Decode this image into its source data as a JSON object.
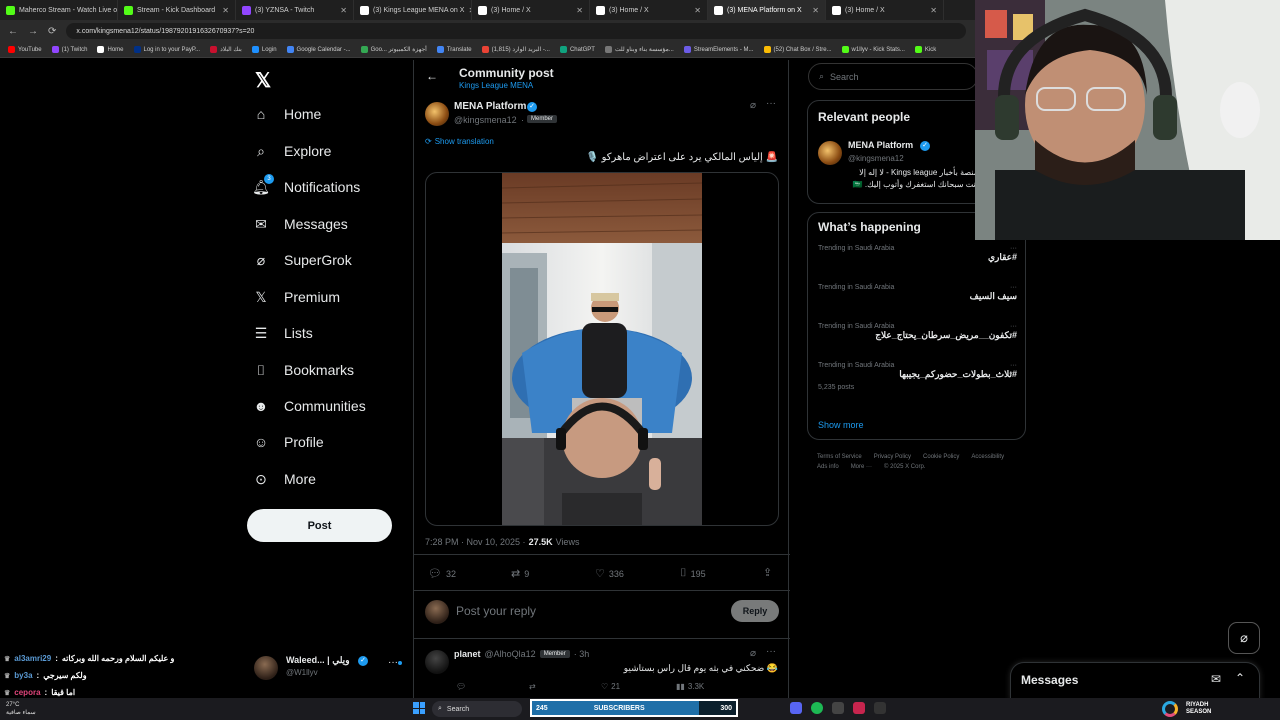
{
  "browser": {
    "tabs": [
      {
        "label": "Maherco Stream - Watch Live o",
        "color": "#53fc18"
      },
      {
        "label": "Stream - Kick Dashboard",
        "color": "#53fc18"
      },
      {
        "label": "(3) YZNSA - Twitch",
        "color": "#9146ff"
      },
      {
        "label": "(3) Kings League MENA on X",
        "color": "#ffffff"
      },
      {
        "label": "(3) Home / X",
        "color": "#ffffff"
      },
      {
        "label": "(3) Home / X",
        "color": "#ffffff"
      },
      {
        "label": "(3) MENA Platform on X",
        "color": "#ffffff"
      },
      {
        "label": "(3) Home / X",
        "color": "#ffffff"
      }
    ],
    "url": "x.com/kingsmena12/status/1987920191632670937?s=20",
    "bookmarks": [
      {
        "label": "YouTube",
        "color": "#ff0000"
      },
      {
        "label": "(1) Twitch",
        "color": "#9146ff"
      },
      {
        "label": "Home",
        "color": "#ffffff"
      },
      {
        "label": "Log in to your PayP...",
        "color": "#003087"
      },
      {
        "label": "بنك البلاد",
        "color": "#c8102e"
      },
      {
        "label": "Login",
        "color": "#1e90ff"
      },
      {
        "label": "Google Calendar -...",
        "color": "#4285f4"
      },
      {
        "label": "Goo... أجهزة الكمبيوتر",
        "color": "#34a853"
      },
      {
        "label": "Translate",
        "color": "#4285f4"
      },
      {
        "label": "(1,815) البريد الوارد -...",
        "color": "#ea4335"
      },
      {
        "label": "ChatGPT",
        "color": "#10a37f"
      },
      {
        "label": "مؤسسة بناء وبناو للت...",
        "color": "#777777"
      },
      {
        "label": "StreamElements - M...",
        "color": "#6c5ce7"
      },
      {
        "label": "(52) Chat Box / Stre...",
        "color": "#fbbc05"
      },
      {
        "label": "w1llyv - Kick Stats...",
        "color": "#53fc18"
      },
      {
        "label": "Kick",
        "color": "#53fc18"
      }
    ]
  },
  "nav": {
    "logo": "𝕏",
    "items": [
      {
        "label": "Home",
        "icon": "home-icon"
      },
      {
        "label": "Explore",
        "icon": "search-icon"
      },
      {
        "label": "Notifications",
        "icon": "bell-icon",
        "badge": "3"
      },
      {
        "label": "Messages",
        "icon": "mail-icon"
      },
      {
        "label": "SuperGrok",
        "icon": "grok-icon"
      },
      {
        "label": "Premium",
        "icon": "x-icon"
      },
      {
        "label": "Lists",
        "icon": "list-icon"
      },
      {
        "label": "Bookmarks",
        "icon": "bookmark-icon"
      },
      {
        "label": "Communities",
        "icon": "people-icon"
      },
      {
        "label": "Profile",
        "icon": "person-icon"
      },
      {
        "label": "More",
        "icon": "more-circle-icon"
      }
    ],
    "post_label": "Post",
    "account": {
      "name": "Waleed... | ويلي",
      "handle": "@W1llyv"
    }
  },
  "main": {
    "header_title": "Community post",
    "header_subtitle": "Kings League MENA",
    "author": {
      "name": "MENA Platform",
      "handle": "@kingsmena12",
      "dot": "·",
      "member": "Member"
    },
    "show_translation": "Show translation",
    "tweet_text": "🚨 إلياس المالكي يرد على اعتراض ماهركو 🎙️",
    "timestamp": "7:28 PM · Nov 10, 2025 ·",
    "views_count": "27.5K",
    "views_label": "Views",
    "actions": {
      "replies": "32",
      "reposts": "9",
      "likes": "336",
      "bookmarks": "195"
    },
    "reply_placeholder": "Post your reply",
    "reply_button": "Reply",
    "reply_post": {
      "name": "planet",
      "handle": "@AlhoQla12",
      "member": "Member",
      "time": "· 3h",
      "text": "😂 ضحكني في بثه يوم قال راس بستاشيو",
      "replies": "",
      "reposts": "",
      "likes": "21",
      "views": "3.3K"
    }
  },
  "right": {
    "search_placeholder": "Search",
    "relevant_title": "Relevant people",
    "relevant_person": {
      "name": "MENA Platform",
      "handle": "@kingsmena12",
      "bio": "منصة بأخبار Kings league - لا إله إلا أنت سبحانك استغفرك وأتوب إليك. 🇸🇦"
    },
    "happening_title": "What’s happening",
    "trends": [
      {
        "meta": "Trending in Saudi Arabia",
        "name": "#عقاري",
        "posts": ""
      },
      {
        "meta": "Trending in Saudi Arabia",
        "name": "سيف السيف",
        "posts": ""
      },
      {
        "meta": "Trending in Saudi Arabia",
        "name": "#تكفون__مريض_سرطان_يحتاج_علاج",
        "posts": ""
      },
      {
        "meta": "Trending in Saudi Arabia",
        "name": "#ثلاث_بطولات_حضوركم_يجيبها",
        "posts": "5,235 posts"
      }
    ],
    "show_more": "Show more",
    "footer": [
      "Terms of Service",
      "Privacy Policy",
      "Cookie Policy",
      "Accessibility",
      "Ads info",
      "More ···",
      "© 2025 X Corp."
    ]
  },
  "chat": [
    {
      "user": "al3amri29",
      "color": "#5b9bd5",
      "text": "و عليكم السلام ورحمه الله وبركاته"
    },
    {
      "user": "by3a",
      "color": "#5b9bd5",
      "text": "ولكم سيرجي"
    },
    {
      "user": "cepora",
      "color": "#e0457b",
      "text": "اما قيقا"
    }
  ],
  "messages_drawer": {
    "title": "Messages"
  },
  "taskbar": {
    "weather_temp": "27°C",
    "weather_text": "سماء صافية",
    "search_label": "Search",
    "subs_count": "245",
    "subs_label": "SUBSCRIBERS",
    "subs_goal": "300",
    "season_label": "RIYADH SEASON"
  }
}
